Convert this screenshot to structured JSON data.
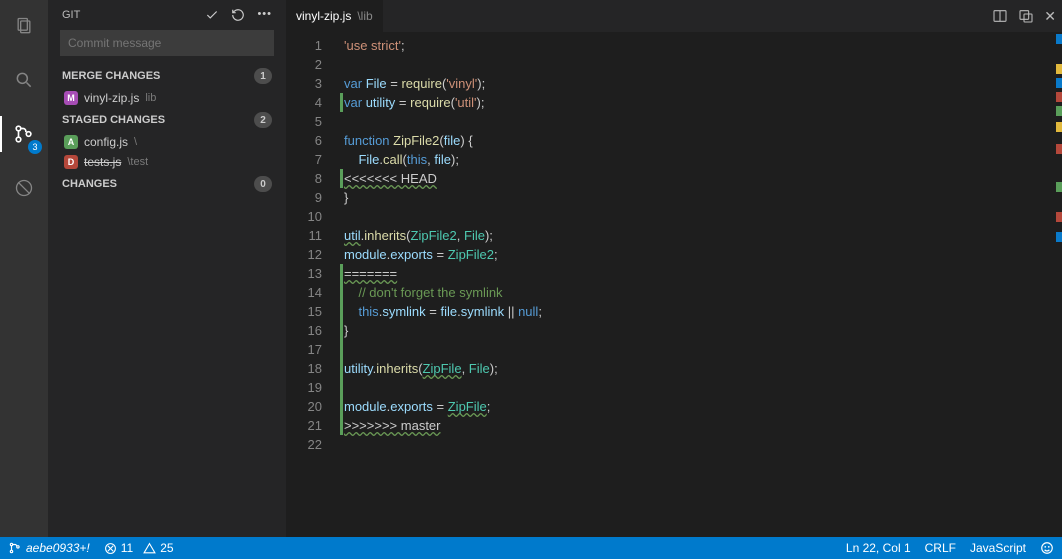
{
  "activity": {
    "scm_badge": "3"
  },
  "sidebar": {
    "title": "GIT",
    "commit_placeholder": "Commit message",
    "sections": {
      "merge": {
        "label": "MERGE CHANGES",
        "count": "1",
        "items": [
          {
            "badge": "M",
            "name": "vinyl-zip.js",
            "path": "lib"
          }
        ]
      },
      "staged": {
        "label": "STAGED CHANGES",
        "count": "2",
        "items": [
          {
            "badge": "A",
            "name": "config.js",
            "path": "\\"
          },
          {
            "badge": "D",
            "name": "tests.js",
            "path": "\\test",
            "strike": true
          }
        ]
      },
      "changes": {
        "label": "CHANGES",
        "count": "0",
        "items": []
      }
    }
  },
  "tab": {
    "name": "vinyl-zip.js",
    "path": "\\lib"
  },
  "code": {
    "lines": [
      {
        "n": 1,
        "html": "<span class='tok-str'>'use strict'</span>;"
      },
      {
        "n": 2,
        "html": ""
      },
      {
        "n": 3,
        "html": "<span class='tok-kw'>var</span> <span class='tok-var'>File</span> = <span class='tok-fn'>require</span>(<span class='tok-str'>'vinyl'</span>);"
      },
      {
        "n": 4,
        "html": "<span class='tok-kw'>var</span> <span class='tok-var'>utility</span> = <span class='tok-fn'>require</span>(<span class='tok-str'>'util'</span>);",
        "greenbar": true
      },
      {
        "n": 5,
        "html": ""
      },
      {
        "n": 6,
        "html": "<span class='tok-kw'>function</span> <span class='tok-fn'>ZipFile2</span>(<span class='tok-var'>file</span>) {"
      },
      {
        "n": 7,
        "html": "    <span class='tok-var'>File</span>.<span class='tok-fn'>call</span>(<span class='tok-this'>this</span>, <span class='tok-var'>file</span>);"
      },
      {
        "n": 8,
        "html": "<span class='tok-conflict squiggle'>&lt;&lt;&lt;&lt;&lt;&lt;&lt; HEAD</span>",
        "conflict": true,
        "greenbar": true
      },
      {
        "n": 9,
        "html": "}"
      },
      {
        "n": 10,
        "html": ""
      },
      {
        "n": 11,
        "html": "<span class='tok-var squiggle'>util</span>.<span class='tok-fn'>inherits</span>(<span class='tok-type'>ZipFile2</span>, <span class='tok-type'>File</span>);"
      },
      {
        "n": 12,
        "html": "<span class='tok-var'>module</span>.<span class='tok-var'>exports</span> = <span class='tok-type'>ZipFile2</span>;"
      },
      {
        "n": 13,
        "html": "<span class='tok-conflict squiggle'>=======</span>",
        "conflict": true,
        "greenbar": true
      },
      {
        "n": 14,
        "html": "    <span class='tok-comment'>// don't forget the symlink</span>",
        "greenbar": true
      },
      {
        "n": 15,
        "html": "    <span class='tok-this'>this</span>.<span class='tok-var'>symlink</span> = <span class='tok-var'>file</span>.<span class='tok-var'>symlink</span> || <span class='tok-null'>null</span>;",
        "greenbar": true
      },
      {
        "n": 16,
        "html": "}",
        "greenbar": true
      },
      {
        "n": 17,
        "html": "",
        "greenbar": true
      },
      {
        "n": 18,
        "html": "<span class='tok-var'>utility</span>.<span class='tok-fn'>inherits</span>(<span class='tok-type squiggle'>ZipFile</span>, <span class='tok-type'>File</span>);",
        "greenbar": true
      },
      {
        "n": 19,
        "html": "",
        "greenbar": true
      },
      {
        "n": 20,
        "html": "<span class='tok-var'>module</span>.<span class='tok-var'>exports</span> = <span class='tok-type squiggle'>ZipFile</span>;",
        "greenbar": true
      },
      {
        "n": 21,
        "html": "<span class='tok-conflict squiggle'>&gt;&gt;&gt;&gt;&gt;&gt;&gt; master</span>",
        "conflict": true,
        "greenbar": true
      },
      {
        "n": 22,
        "html": ""
      }
    ]
  },
  "status": {
    "branch": "aebe0933+!",
    "errors": "11",
    "warnings": "25",
    "cursor": "Ln 22, Col 1",
    "eol": "CRLF",
    "lang": "JavaScript"
  }
}
